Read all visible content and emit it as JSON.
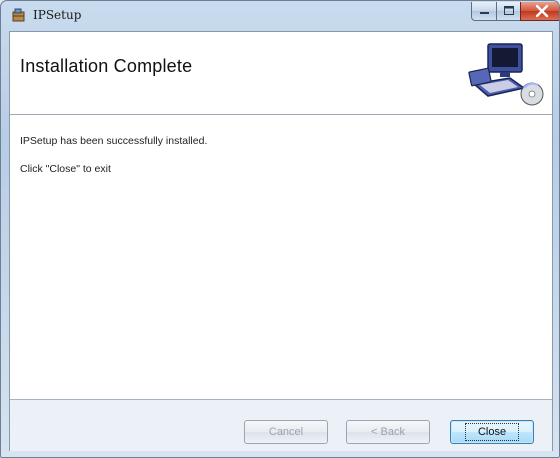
{
  "window": {
    "title": "IPSetup",
    "app_icon": "setup-box-icon",
    "caption_buttons": [
      "minimize-icon",
      "maximize-icon",
      "close-icon"
    ]
  },
  "banner": {
    "title": "Installation Complete",
    "graphic": "computer-install-icon"
  },
  "body": {
    "message_line1": "IPSetup has been successfully installed.",
    "message_line2": "Click \"Close\" to exit"
  },
  "buttons": {
    "cancel_label": "Cancel",
    "back_label": "< Back",
    "close_label": "Close"
  },
  "colors": {
    "close_caption": "#c0371d",
    "default_button_border": "#3c7fb1"
  }
}
